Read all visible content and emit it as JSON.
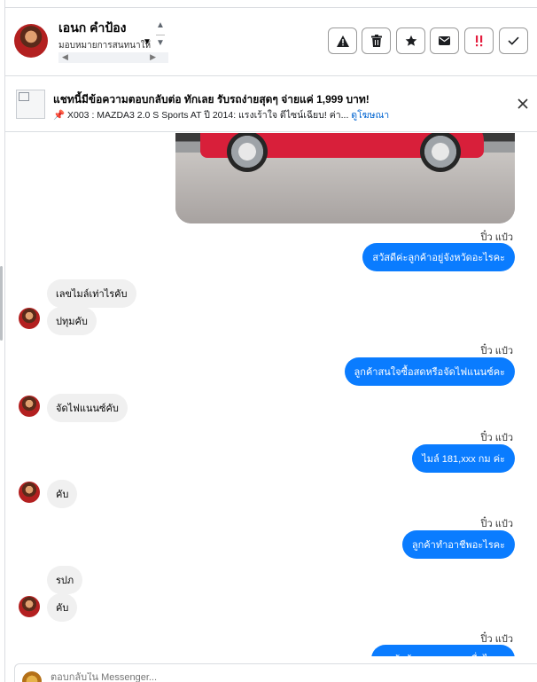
{
  "header": {
    "contact_name": "เอนก คำป้อง",
    "assign_label": "มอบหมายการสนทนาให้"
  },
  "toolbar": {
    "actions": [
      {
        "icon": "warning-icon"
      },
      {
        "icon": "trash-icon"
      },
      {
        "icon": "star-icon"
      },
      {
        "icon": "envelope-icon"
      },
      {
        "icon": "follow-up-icon"
      },
      {
        "icon": "check-icon"
      }
    ]
  },
  "ad": {
    "title": "แชทนี้มีข้อความตอบกลับต่อ ทักเลย รับรถง่ายสุดๆ จ่ายแค่ 1,999 บาท!",
    "pin_emoji": "📌",
    "subtitle": "X003 : MAZDA3 2.0 S Sports AT ปี 2014: แรงเร้าใจ ดีไซน์เฉียบ! ค่า...",
    "link": "ดูโฆษณา"
  },
  "messages": [
    {
      "sender": "ปิ๋ว แป๋ว",
      "text": "สวัสดีค่ะลูกค้าอยู่จังหวัดอะไรคะ"
    },
    {
      "text": "เลขไมล์เท่าไรคับ"
    },
    {
      "text": "ปทุมคับ"
    },
    {
      "sender": "ปิ๋ว แป๋ว",
      "text": "ลูกค้าสนใจซื้อสดหรือจัดไฟแนนซ์คะ"
    },
    {
      "text": "จัดไฟแนนซ์คับ"
    },
    {
      "sender": "ปิ๋ว แป๋ว",
      "text": "ไมล์ 181,xxx  กม ค่ะ"
    },
    {
      "text": "คับ"
    },
    {
      "sender": "ปิ๋ว แป๋ว",
      "text": "ลูกค้าทำอาชีพอะไรคะ"
    },
    {
      "text": "รปภ"
    },
    {
      "text": "คับ"
    },
    {
      "sender": "ปิ๋ว แป๋ว",
      "text": "ลูกค้าต้องการออกรถเมื่อไรคะ"
    }
  ],
  "composer": {
    "placeholder": "ตอบกลับใน Messenger..."
  }
}
